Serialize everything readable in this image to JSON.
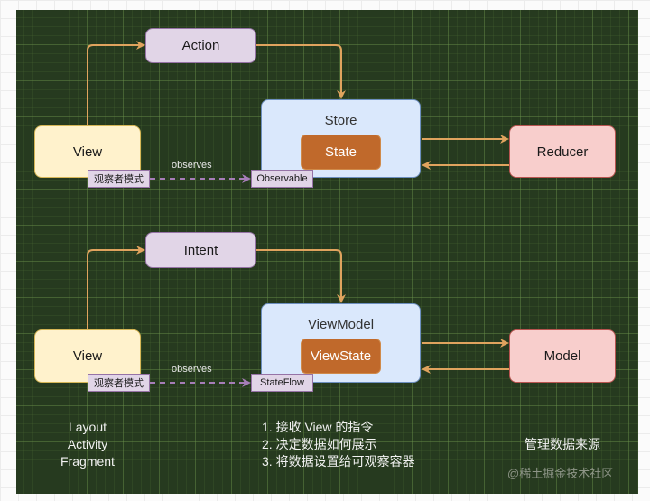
{
  "diagram": {
    "top": {
      "action": "Action",
      "view": "View",
      "store": "Store",
      "state": "State",
      "reducer": "Reducer",
      "observer_tag": "观察者模式",
      "observes_label": "observes",
      "observable_tag": "Observable"
    },
    "bottom": {
      "intent": "Intent",
      "view": "View",
      "viewmodel": "ViewModel",
      "viewstate": "ViewState",
      "model": "Model",
      "observer_tag": "观察者模式",
      "observes_label": "observes",
      "stateflow_tag": "StateFlow"
    },
    "captions": {
      "view_roles": [
        "Layout",
        "Activity",
        "Fragment"
      ],
      "viewmodel_duties": [
        "1. 接收 View 的指令",
        "2. 决定数据如何展示",
        "3. 将数据设置给可观察容器"
      ],
      "model_role": "管理数据来源"
    },
    "watermark": "@稀土掘金技术社区",
    "colors": {
      "arrow": "#e0a35e",
      "dashed": "#a67db8",
      "canvas": "#263a1f"
    }
  }
}
